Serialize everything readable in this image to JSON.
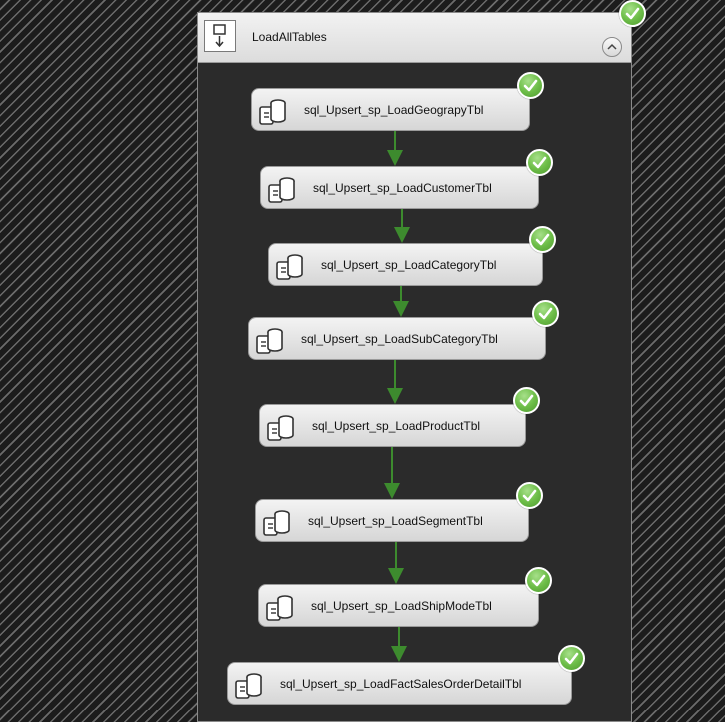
{
  "container": {
    "title": "LoadAllTables",
    "sequence_icon": "sequence-container-icon",
    "collapse_icon": "chevron-up-icon",
    "status_icon": "success-check-icon"
  },
  "tasks": [
    {
      "label": "sql_Upsert_sp_LoadGeograpyTbl",
      "icon": "execute-sql-task-icon",
      "status": "success-check-icon"
    },
    {
      "label": "sql_Upsert_sp_LoadCustomerTbl",
      "icon": "execute-sql-task-icon",
      "status": "success-check-icon"
    },
    {
      "label": "sql_Upsert_sp_LoadCategoryTbl",
      "icon": "execute-sql-task-icon",
      "status": "success-check-icon"
    },
    {
      "label": "sql_Upsert_sp_LoadSubCategoryTbl",
      "icon": "execute-sql-task-icon",
      "status": "success-check-icon"
    },
    {
      "label": "sql_Upsert_sp_LoadProductTbl",
      "icon": "execute-sql-task-icon",
      "status": "success-check-icon"
    },
    {
      "label": "sql_Upsert_sp_LoadSegmentTbl",
      "icon": "execute-sql-task-icon",
      "status": "success-check-icon"
    },
    {
      "label": "sql_Upsert_sp_LoadShipModeTbl",
      "icon": "execute-sql-task-icon",
      "status": "success-check-icon"
    },
    {
      "label": "sql_Upsert_sp_LoadFactSalesOrderDetailTbl",
      "icon": "execute-sql-task-icon",
      "status": "success-check-icon"
    }
  ],
  "colors": {
    "precedence_arrow": "#3d8b2e",
    "success_badge": "#6fbf4a"
  }
}
